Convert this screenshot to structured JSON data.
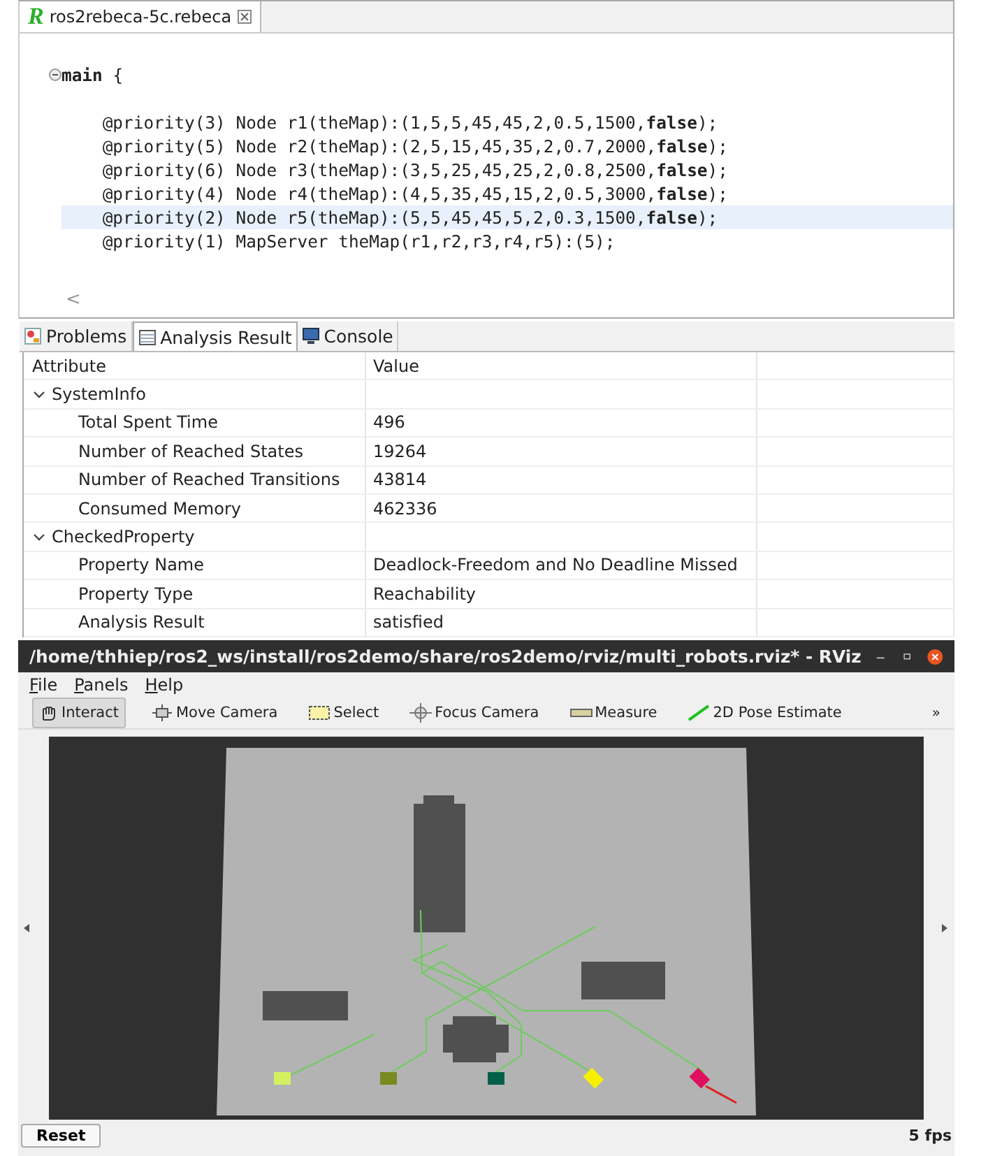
{
  "editor": {
    "tab": {
      "logo_letter": "R",
      "title": "ros2rebeca-5c.rebeca"
    },
    "lines": [
      {
        "highlighted": false
      },
      {
        "text": "**main** {",
        "highlighted": false,
        "foldable": true
      },
      {
        "highlighted": false
      },
      {
        "text": "    @priority(3) Node r1(theMap):(1,5,5,45,45,2,0.5,1500,**false**);",
        "highlighted": false
      },
      {
        "text": "    @priority(5) Node r2(theMap):(2,5,15,45,35,2,0.7,2000,**false**);",
        "highlighted": false
      },
      {
        "text": "    @priority(6) Node r3(theMap):(3,5,25,45,25,2,0.8,2500,**false**);",
        "highlighted": false
      },
      {
        "text": "    @priority(4) Node r4(theMap):(4,5,35,45,15,2,0.5,3000,**false**);",
        "highlighted": false
      },
      {
        "text": "    @priority(2) Node r5(theMap):(5,5,45,45,5,2,0.3,1500,**false**);",
        "highlighted": true
      },
      {
        "text": "    @priority(1) MapServer theMap(r1,r2,r3,r4,r5):(5);",
        "highlighted": false
      }
    ],
    "scroll_left": "<"
  },
  "panel": {
    "tabs": [
      {
        "label": "Problems",
        "selected": false,
        "kind": "problems"
      },
      {
        "label": "Analysis Result",
        "selected": true,
        "kind": "table"
      },
      {
        "label": "Console",
        "selected": false,
        "kind": "console"
      }
    ],
    "table": {
      "columns": [
        "Attribute",
        "Value"
      ],
      "rows": [
        {
          "attribute": "SystemInfo",
          "expanded": true,
          "children": [
            {
              "attribute": "Total Spent Time",
              "value": "496"
            },
            {
              "attribute": "Number of Reached States",
              "value": "19264"
            },
            {
              "attribute": "Number of Reached Transitions",
              "value": "43814"
            },
            {
              "attribute": "Consumed Memory",
              "value": "462336"
            }
          ]
        },
        {
          "attribute": "CheckedProperty",
          "expanded": true,
          "children": [
            {
              "attribute": "Property Name",
              "value": "Deadlock-Freedom and No Deadline Missed"
            },
            {
              "attribute": "Property Type",
              "value": "Reachability"
            },
            {
              "attribute": "Analysis Result",
              "value": "satisfied"
            }
          ]
        }
      ]
    }
  },
  "rviz": {
    "title": "/home/thhiep/ros2_ws/install/ros2demo/share/ros2demo/rviz/multi_robots.rviz* - RViz",
    "menu": [
      "File",
      "Panels",
      "Help"
    ],
    "tools": [
      {
        "label": "Interact",
        "selected": true,
        "kind": "hand"
      },
      {
        "label": "Move Camera",
        "selected": false,
        "kind": "move"
      },
      {
        "label": "Select",
        "selected": false,
        "kind": "select"
      },
      {
        "label": "Focus Camera",
        "selected": false,
        "kind": "focus"
      },
      {
        "label": "Measure",
        "selected": false,
        "kind": "measure"
      },
      {
        "label": "2D Pose Estimate",
        "selected": false,
        "kind": "pose"
      }
    ],
    "overflow": "»",
    "robots": [
      {
        "color": "#d4f060"
      },
      {
        "color": "#788a20"
      },
      {
        "color": "#006048"
      },
      {
        "color": "#f8f000"
      },
      {
        "color": "#e01060"
      }
    ],
    "reset": "Reset",
    "fps": "5 fps"
  }
}
